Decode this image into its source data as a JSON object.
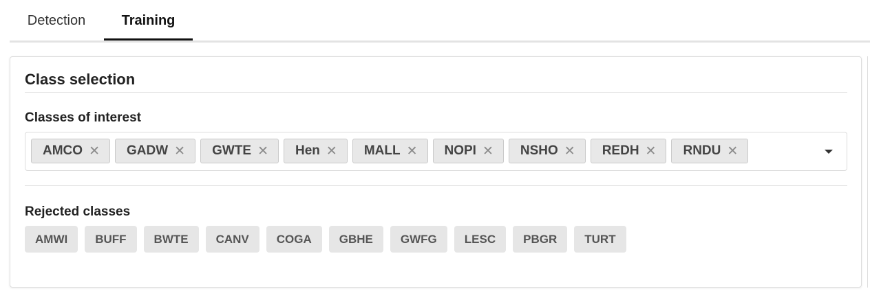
{
  "tabs": [
    {
      "label": "Detection",
      "active": false
    },
    {
      "label": "Training",
      "active": true
    }
  ],
  "panel": {
    "title": "Class selection",
    "classes_of_interest": {
      "label": "Classes of interest",
      "selected": [
        "AMCO",
        "GADW",
        "GWTE",
        "Hen",
        "MALL",
        "NOPI",
        "NSHO",
        "REDH",
        "RNDU"
      ],
      "remove_icon": "close-icon",
      "dropdown_icon": "caret-down-icon"
    },
    "rejected_classes": {
      "label": "Rejected classes",
      "items": [
        "AMWI",
        "BUFF",
        "BWTE",
        "CANV",
        "COGA",
        "GBHE",
        "GWFG",
        "LESC",
        "PBGR",
        "TURT"
      ]
    }
  },
  "colors": {
    "active_tab_underline": "#111111",
    "chip_background": "#e8e8e8",
    "chip_border": "#c9c9c9",
    "rejected_chip_background": "#e6e6e6"
  }
}
